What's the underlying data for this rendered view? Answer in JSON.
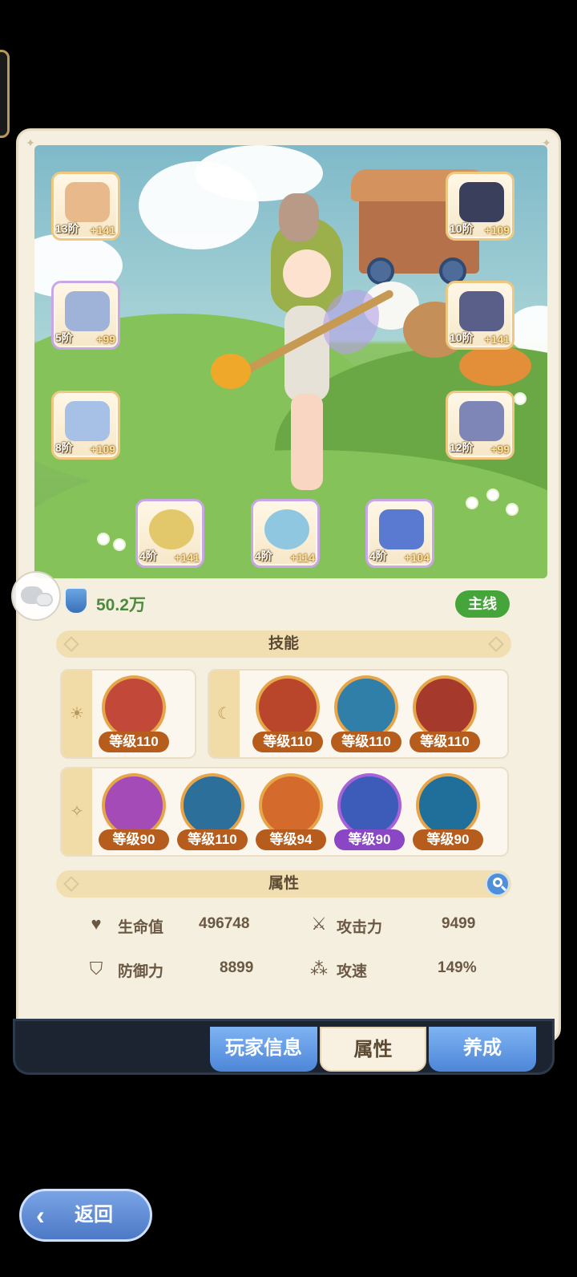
{
  "power": {
    "value": "50.2万",
    "mode_badge": "主线"
  },
  "equipment": [
    {
      "slot": "bow",
      "level": "13阶",
      "bonus": "+141",
      "color": "#e8b98a"
    },
    {
      "slot": "helmet",
      "level": "10阶",
      "bonus": "+109",
      "color": "#3a3f5c"
    },
    {
      "slot": "armor",
      "level": "5阶",
      "bonus": "+99",
      "color": "#9fb3d8"
    },
    {
      "slot": "gauntlet",
      "level": "10阶",
      "bonus": "+141",
      "color": "#5a5f8a"
    },
    {
      "slot": "pants",
      "level": "8阶",
      "bonus": "+109",
      "color": "#a7c0e6"
    },
    {
      "slot": "boots",
      "level": "12阶",
      "bonus": "+99",
      "color": "#7d86b6"
    },
    {
      "slot": "ring",
      "level": "4阶",
      "bonus": "+141",
      "color": "#e2c86a"
    },
    {
      "slot": "necklace",
      "level": "4阶",
      "bonus": "+114",
      "color": "#8fc7e0"
    },
    {
      "slot": "charm",
      "level": "4阶",
      "bonus": "+104",
      "color": "#5a7ad1"
    }
  ],
  "skills_title": "技能",
  "skills": {
    "sun": [
      {
        "level": "等级110",
        "color": "#c2493a"
      }
    ],
    "moon": [
      {
        "level": "等级110",
        "color": "#b9452a"
      },
      {
        "level": "等级110",
        "color": "#2f7fa8"
      },
      {
        "level": "等级110",
        "color": "#a53a2c"
      }
    ],
    "star": [
      {
        "level": "等级90",
        "color": "#a54bb8"
      },
      {
        "level": "等级110",
        "color": "#2b6f9a"
      },
      {
        "level": "等级94",
        "color": "#d46a2c"
      },
      {
        "level": "等级90",
        "color": "#3d5bb8",
        "purple": true
      },
      {
        "level": "等级90",
        "color": "#1f6f9a"
      }
    ]
  },
  "attributes_title": "属性",
  "attributes": {
    "hp_label": "生命值",
    "hp_value": "496748",
    "atk_label": "攻击力",
    "atk_value": "9499",
    "def_label": "防御力",
    "def_value": "8899",
    "spd_label": "攻速",
    "spd_value": "149%"
  },
  "tabs": {
    "player_info": "玩家信息",
    "attributes": "属性",
    "develop": "养成"
  },
  "back_label": "返回"
}
